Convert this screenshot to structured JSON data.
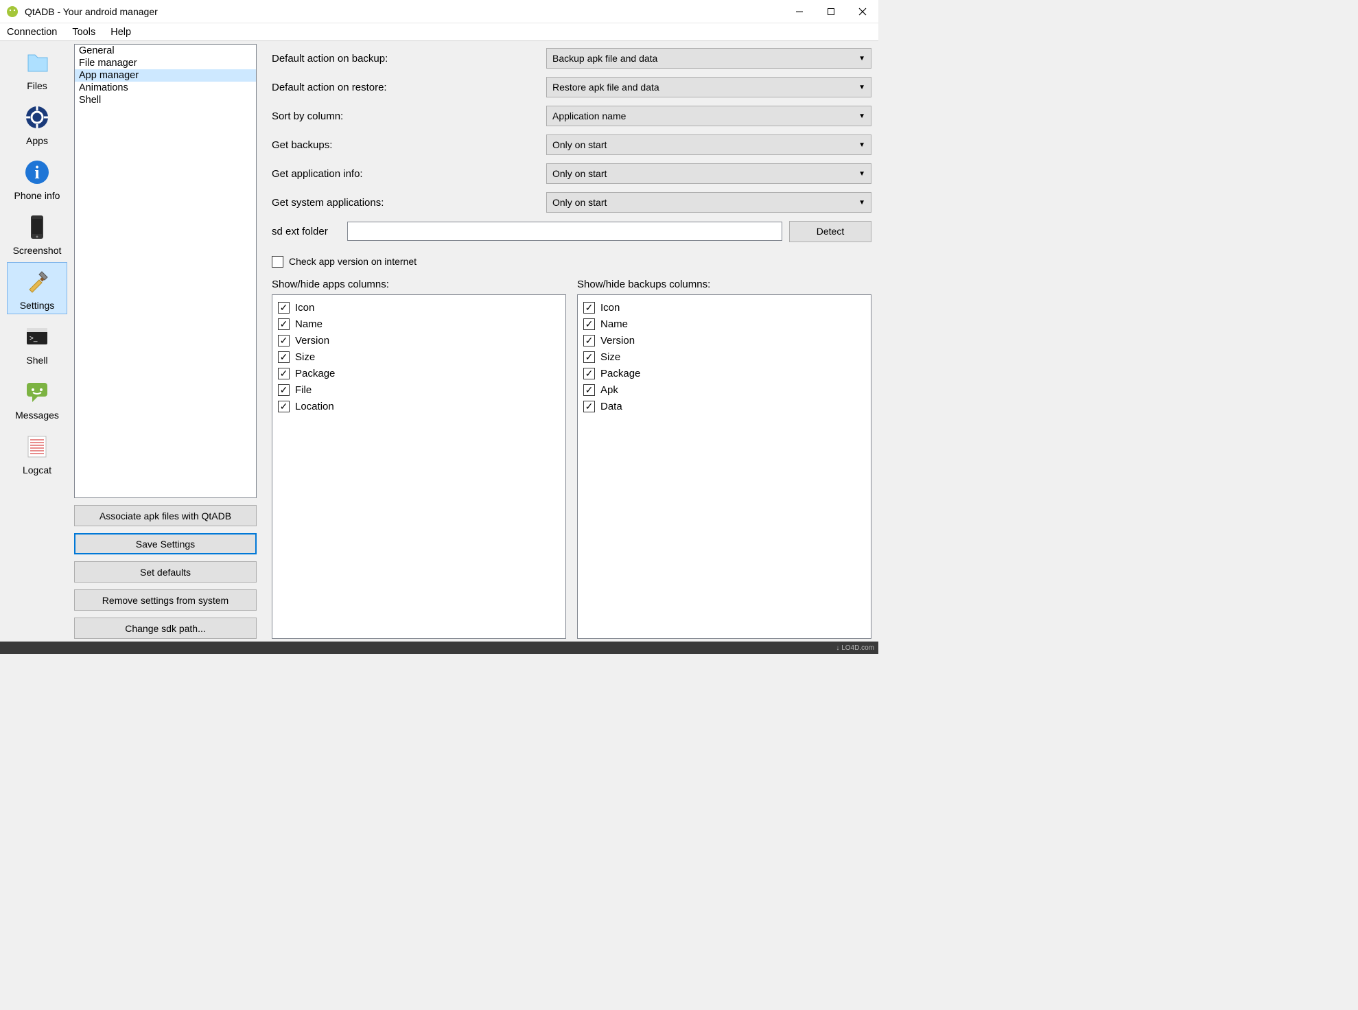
{
  "window": {
    "title": "QtADB - Your android manager"
  },
  "menu": {
    "items": [
      "Connection",
      "Tools",
      "Help"
    ]
  },
  "sidebar": {
    "items": [
      {
        "id": "files",
        "label": "Files"
      },
      {
        "id": "apps",
        "label": "Apps"
      },
      {
        "id": "phone-info",
        "label": "Phone info"
      },
      {
        "id": "screenshot",
        "label": "Screenshot"
      },
      {
        "id": "settings",
        "label": "Settings"
      },
      {
        "id": "shell",
        "label": "Shell"
      },
      {
        "id": "messages",
        "label": "Messages"
      },
      {
        "id": "logcat",
        "label": "Logcat"
      }
    ],
    "selected": "settings"
  },
  "categories": {
    "items": [
      "General",
      "File manager",
      "App manager",
      "Animations",
      "Shell"
    ],
    "selected": "App manager"
  },
  "category_buttons": {
    "associate": "Associate apk files with QtADB",
    "save": "Save Settings",
    "defaults": "Set defaults",
    "remove": "Remove settings from system",
    "sdk": "Change sdk path..."
  },
  "settings": {
    "default_backup": {
      "label": "Default action on backup:",
      "value": "Backup apk file and data"
    },
    "default_restore": {
      "label": "Default action on restore:",
      "value": "Restore apk file and data"
    },
    "sort_column": {
      "label": "Sort by column:",
      "value": "Application name"
    },
    "get_backups": {
      "label": "Get backups:",
      "value": "Only on start"
    },
    "get_app_info": {
      "label": "Get application info:",
      "value": "Only on start"
    },
    "get_sys_apps": {
      "label": "Get system applications:",
      "value": "Only on start"
    },
    "sd_ext": {
      "label": "sd ext folder",
      "value": ""
    },
    "detect": "Detect",
    "check_version": {
      "checked": false,
      "label": "Check app version on internet"
    },
    "apps_columns": {
      "title": "Show/hide apps columns:",
      "items": [
        {
          "label": "Icon",
          "checked": true
        },
        {
          "label": "Name",
          "checked": true
        },
        {
          "label": "Version",
          "checked": true
        },
        {
          "label": "Size",
          "checked": true
        },
        {
          "label": "Package",
          "checked": true
        },
        {
          "label": "File",
          "checked": true
        },
        {
          "label": "Location",
          "checked": true
        }
      ]
    },
    "backups_columns": {
      "title": "Show/hide backups columns:",
      "items": [
        {
          "label": "Icon",
          "checked": true
        },
        {
          "label": "Name",
          "checked": true
        },
        {
          "label": "Version",
          "checked": true
        },
        {
          "label": "Size",
          "checked": true
        },
        {
          "label": "Package",
          "checked": true
        },
        {
          "label": "Apk",
          "checked": true
        },
        {
          "label": "Data",
          "checked": true
        }
      ]
    }
  },
  "footer": {
    "watermark": "↓ LO4D.com"
  }
}
